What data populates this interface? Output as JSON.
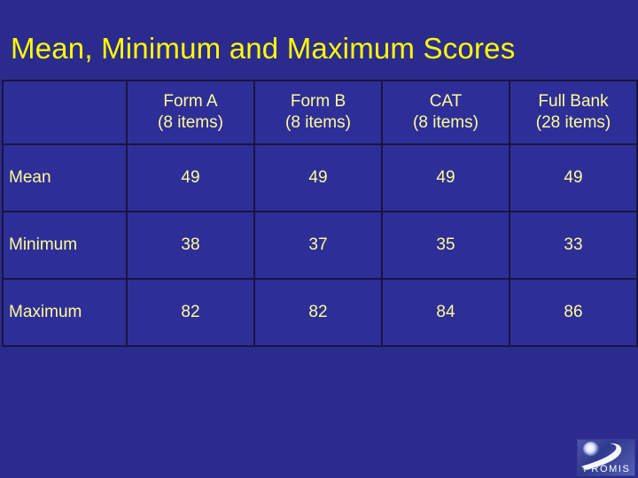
{
  "slide": {
    "title": "Mean, Minimum and Maximum Scores",
    "background_color": "#2b2b8e",
    "title_color": "#ffff00",
    "cell_text_color": "#fdfd96",
    "cell_fill_color": "#2e2e99",
    "border_color": "#16163f"
  },
  "table": {
    "corner_label": "",
    "columns": [
      {
        "name": "Form A",
        "subtitle": "(8 items)"
      },
      {
        "name": "Form B",
        "subtitle": "(8 items)"
      },
      {
        "name": "CAT",
        "subtitle": "(8 items)"
      },
      {
        "name": "Full Bank",
        "subtitle": "(28 items)"
      }
    ],
    "rows": [
      {
        "label": "Mean",
        "values": [
          "49",
          "49",
          "49",
          "49"
        ]
      },
      {
        "label": "Minimum",
        "values": [
          "38",
          "37",
          "35",
          "33"
        ]
      },
      {
        "label": "Maximum",
        "values": [
          "82",
          "82",
          "84",
          "86"
        ]
      }
    ]
  },
  "chart_data": {
    "type": "table",
    "title": "Mean, Minimum and Maximum Scores",
    "categories": [
      "Form A (8 items)",
      "Form B (8 items)",
      "CAT (8 items)",
      "Full Bank (28 items)"
    ],
    "series": [
      {
        "name": "Mean",
        "values": [
          49,
          49,
          49,
          49
        ]
      },
      {
        "name": "Minimum",
        "values": [
          38,
          37,
          35,
          33
        ]
      },
      {
        "name": "Maximum",
        "values": [
          82,
          82,
          84,
          86
        ]
      }
    ],
    "xlabel": "",
    "ylabel": "",
    "grid": true,
    "legend": "none"
  },
  "logo": {
    "text": "PROMIS"
  }
}
